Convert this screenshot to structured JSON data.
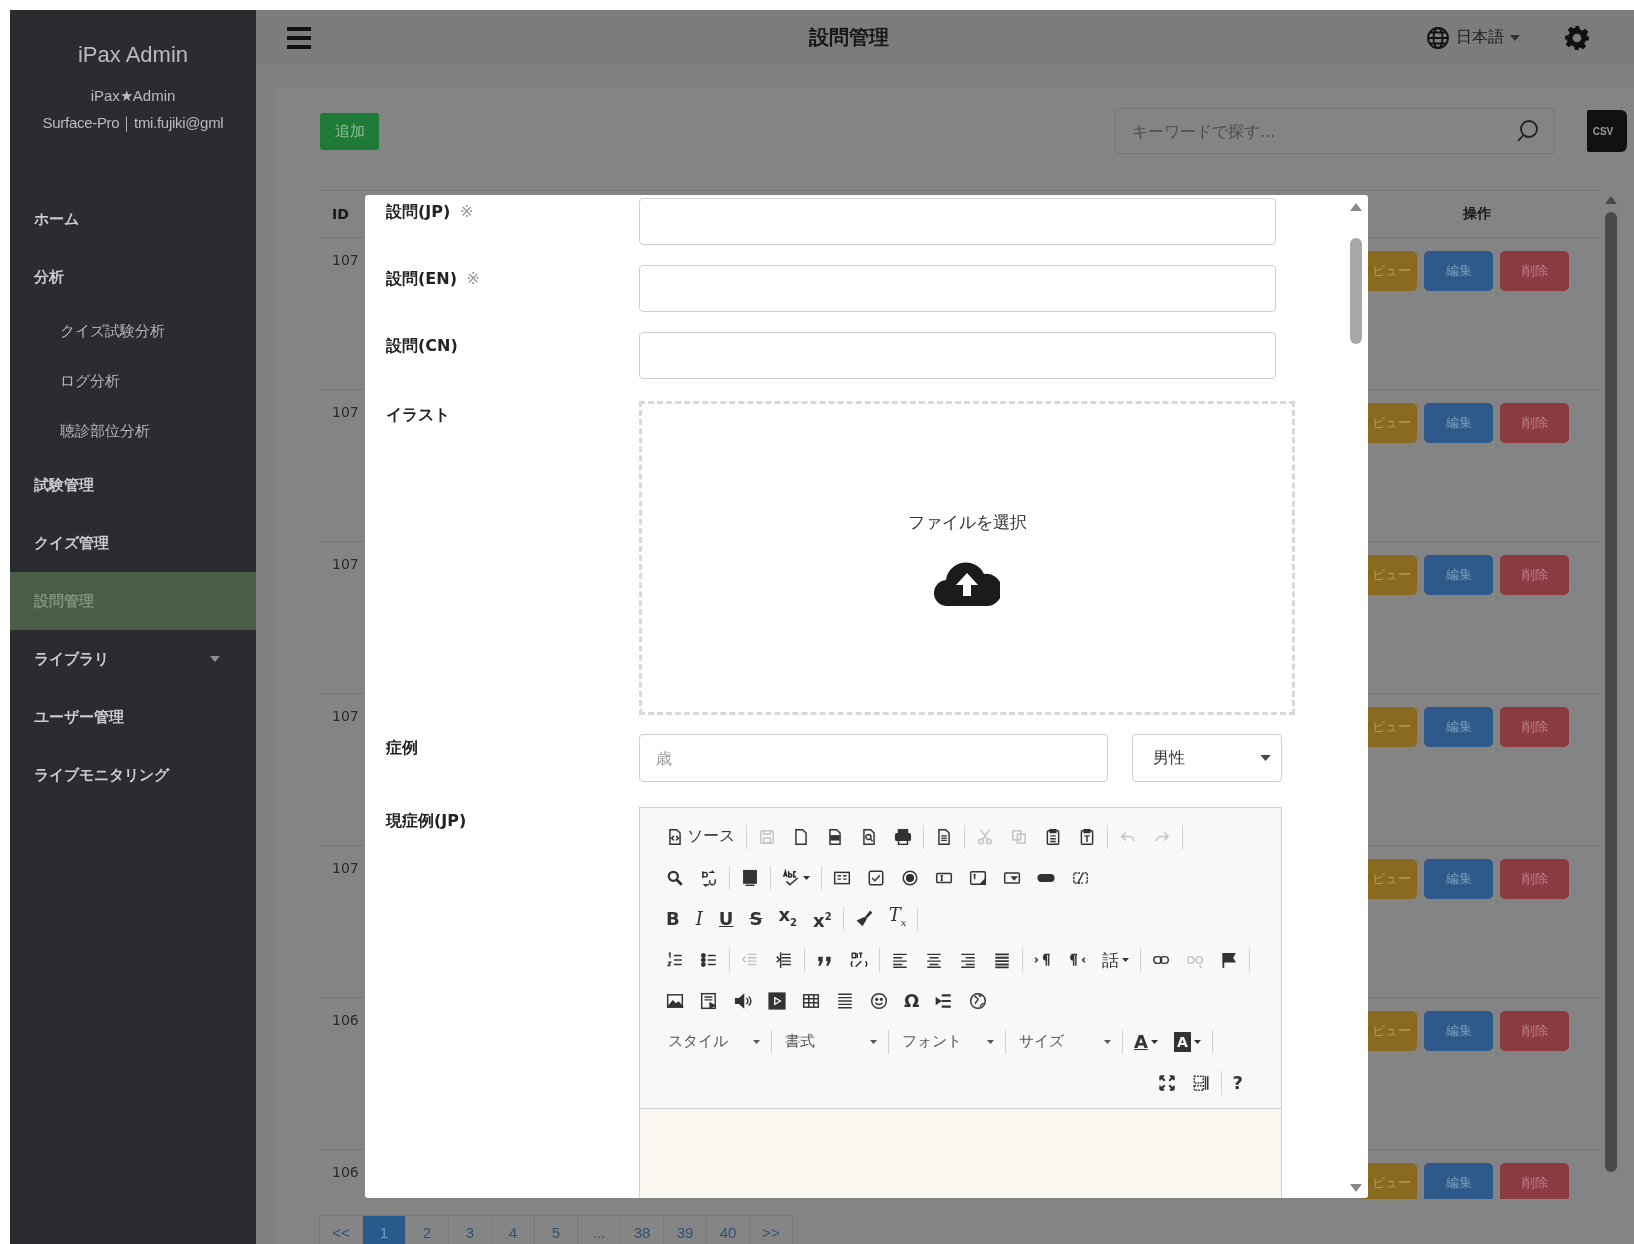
{
  "sidebar": {
    "title": "iPax Admin",
    "user": "iPax★Admin",
    "device": "Surface-Pro｜tmi.fujiki@gml",
    "items": [
      {
        "label": "ホーム",
        "kind": "link",
        "selected": false
      },
      {
        "label": "分析",
        "kind": "link",
        "selected": false,
        "children": [
          {
            "label": "クイズ試験分析",
            "selected": false
          },
          {
            "label": "ログ分析",
            "selected": false
          },
          {
            "label": "聴診部位分析",
            "selected": false
          }
        ]
      },
      {
        "label": "試験管理",
        "kind": "link",
        "selected": false
      },
      {
        "label": "クイズ管理",
        "kind": "link",
        "selected": false
      },
      {
        "label": "設問管理",
        "kind": "link",
        "selected": true
      },
      {
        "label": "ライブラリ",
        "kind": "group",
        "selected": false
      },
      {
        "label": "ユーザー管理",
        "kind": "link",
        "selected": false
      },
      {
        "label": "ライブモニタリング",
        "kind": "link",
        "selected": false
      }
    ]
  },
  "header": {
    "title": "設問管理",
    "language": "日本語"
  },
  "toolbar": {
    "add": "追加",
    "search_placeholder": "キーワードで探す...",
    "export": "CSV"
  },
  "table": {
    "columns": [
      "ID",
      "操作"
    ],
    "rows": [
      {
        "id": "107",
        "actions": [
          {
            "kind": "preview",
            "label": "ビュー"
          },
          {
            "kind": "edit",
            "label": "編集"
          },
          {
            "kind": "delete",
            "label": "削除"
          }
        ]
      },
      {
        "id": "107",
        "actions": [
          {
            "kind": "preview",
            "label": "ビュー"
          },
          {
            "kind": "edit",
            "label": "編集"
          },
          {
            "kind": "delete",
            "label": "削除"
          }
        ]
      },
      {
        "id": "107",
        "actions": [
          {
            "kind": "preview",
            "label": "ビュー"
          },
          {
            "kind": "edit",
            "label": "編集"
          },
          {
            "kind": "delete",
            "label": "削除"
          }
        ]
      },
      {
        "id": "107",
        "actions": [
          {
            "kind": "preview",
            "label": "ビュー"
          },
          {
            "kind": "edit",
            "label": "編集"
          },
          {
            "kind": "delete",
            "label": "削除"
          }
        ]
      },
      {
        "id": "107",
        "actions": [
          {
            "kind": "preview",
            "label": "ビュー"
          },
          {
            "kind": "edit",
            "label": "編集"
          },
          {
            "kind": "delete",
            "label": "削除"
          }
        ]
      },
      {
        "id": "106",
        "actions": [
          {
            "kind": "preview",
            "label": "ビュー"
          },
          {
            "kind": "edit",
            "label": "編集"
          },
          {
            "kind": "delete",
            "label": "削除"
          }
        ]
      },
      {
        "id": "106",
        "actions": [
          {
            "kind": "preview",
            "label": "ビュー"
          },
          {
            "kind": "edit",
            "label": "編集"
          },
          {
            "kind": "delete",
            "label": "削除"
          }
        ]
      }
    ]
  },
  "pagination": [
    {
      "label": "<<",
      "selected": false
    },
    {
      "label": "1",
      "selected": true
    },
    {
      "label": "2",
      "selected": false
    },
    {
      "label": "3",
      "selected": false
    },
    {
      "label": "4",
      "selected": false
    },
    {
      "label": "5",
      "selected": false
    },
    {
      "label": "...",
      "selected": false
    },
    {
      "label": "38",
      "selected": false
    },
    {
      "label": "39",
      "selected": false
    },
    {
      "label": "40",
      "selected": false
    },
    {
      "label": ">>",
      "selected": false
    }
  ],
  "modal": {
    "fields": [
      {
        "kind": "text",
        "label": "設問(JP)",
        "note": "※"
      },
      {
        "kind": "text",
        "label": "設問(EN)",
        "note": "※"
      },
      {
        "kind": "text",
        "label": "設問(CN)"
      },
      {
        "kind": "upload",
        "label": "イラスト",
        "prompt": "ファイルを選択"
      },
      {
        "kind": "case",
        "label": "症例",
        "age_placeholder": "歳",
        "sex": "男性"
      },
      {
        "kind": "editor",
        "label": "現症例(JP)",
        "toolbar": [
          [
            {
              "kind": "label_button",
              "label": "ソース"
            },
            {
              "kind": "sep"
            },
            {
              "kind": "icon",
              "disabled": true
            },
            {
              "kind": "icon",
              "disabled": false
            },
            {
              "kind": "icon",
              "disabled": false
            },
            {
              "kind": "icon",
              "disabled": false
            },
            {
              "kind": "icon",
              "disabled": false
            },
            {
              "kind": "sep"
            },
            {
              "kind": "icon",
              "disabled": false
            },
            {
              "kind": "sep"
            },
            {
              "kind": "icon",
              "disabled": true
            },
            {
              "kind": "icon",
              "disabled": true
            },
            {
              "kind": "icon",
              "disabled": false
            },
            {
              "kind": "icon",
              "disabled": false
            },
            {
              "kind": "sep"
            },
            {
              "kind": "icon",
              "disabled": true
            },
            {
              "kind": "icon",
              "disabled": true
            },
            {
              "kind": "sep"
            }
          ],
          [
            {
              "kind": "icon",
              "disabled": false
            },
            {
              "kind": "icon",
              "disabled": false
            },
            {
              "kind": "sep"
            },
            {
              "kind": "icon",
              "disabled": false
            },
            {
              "kind": "sep"
            },
            {
              "kind": "icon_menu",
              "disabled": false
            },
            {
              "kind": "sep"
            },
            {
              "kind": "icon",
              "disabled": false
            },
            {
              "kind": "icon",
              "disabled": false
            },
            {
              "kind": "icon",
              "disabled": false
            },
            {
              "kind": "icon",
              "disabled": false
            },
            {
              "kind": "icon",
              "disabled": false
            },
            {
              "kind": "icon",
              "disabled": false
            },
            {
              "kind": "icon",
              "disabled": false
            },
            {
              "kind": "icon",
              "disabled": false
            }
          ],
          [
            {
              "kind": "glyph",
              "text": "B",
              "disabled": false
            },
            {
              "kind": "glyph",
              "text": "I",
              "disabled": false
            },
            {
              "kind": "glyph",
              "text": "U",
              "disabled": false
            },
            {
              "kind": "glyph",
              "text": "S",
              "disabled": false
            },
            {
              "kind": "glyph",
              "text": "x$_{2}$",
              "disabled": false
            },
            {
              "kind": "glyph",
              "text": "x$^{2}$",
              "disabled": false
            },
            {
              "kind": "sep"
            },
            {
              "kind": "icon",
              "disabled": false
            },
            {
              "kind": "glyph",
              "text": "T$_{x}$",
              "disabled": false
            },
            {
              "kind": "sep"
            }
          ],
          [
            {
              "kind": "icon",
              "disabled": false
            },
            {
              "kind": "icon",
              "disabled": false
            },
            {
              "kind": "sep"
            },
            {
              "kind": "icon",
              "disabled": true
            },
            {
              "kind": "icon",
              "disabled": false
            },
            {
              "kind": "sep"
            },
            {
              "kind": "icon",
              "disabled": false
            },
            {
              "kind": "icon",
              "disabled": false
            },
            {
              "kind": "sep"
            },
            {
              "kind": "icon",
              "disabled": false
            },
            {
              "kind": "icon",
              "disabled": false
            },
            {
              "kind": "icon",
              "disabled": false
            },
            {
              "kind": "icon",
              "disabled": false
            },
            {
              "kind": "sep"
            },
            {
              "kind": "icon",
              "disabled": false
            },
            {
              "kind": "icon",
              "disabled": false
            },
            {
              "kind": "glyph_menu",
              "text": "話",
              "disabled": false
            },
            {
              "kind": "sep"
            },
            {
              "kind": "icon",
              "disabled": false
            },
            {
              "kind": "icon",
              "disabled": true
            },
            {
              "kind": "icon",
              "disabled": false
            },
            {
              "kind": "sep"
            }
          ],
          [
            {
              "kind": "icon",
              "disabled": false
            },
            {
              "kind": "icon",
              "disabled": false
            },
            {
              "kind": "icon",
              "disabled": false
            },
            {
              "kind": "icon",
              "disabled": false
            },
            {
              "kind": "icon",
              "disabled": false
            },
            {
              "kind": "icon",
              "disabled": false
            },
            {
              "kind": "icon",
              "disabled": false
            },
            {
              "kind": "glyph",
              "text": "Ω",
              "disabled": false
            },
            {
              "kind": "icon",
              "disabled": false
            },
            {
              "kind": "icon",
              "disabled": false
            }
          ],
          [
            {
              "kind": "dropdown",
              "label": "スタイル"
            },
            {
              "kind": "sep"
            },
            {
              "kind": "dropdown",
              "label": "書式"
            },
            {
              "kind": "sep"
            },
            {
              "kind": "dropdown",
              "label": "フォント"
            },
            {
              "kind": "sep"
            },
            {
              "kind": "dropdown",
              "label": "サイズ"
            },
            {
              "kind": "sep"
            },
            {
              "kind": "glyph_menu",
              "text": "A",
              "disabled": false
            },
            {
              "kind": "glyph_menu",
              "text": "A",
              "disabled": false
            },
            {
              "kind": "sep"
            }
          ],
          [
            {
              "kind": "icon",
              "disabled": false
            },
            {
              "kind": "icon",
              "disabled": false
            },
            {
              "kind": "sep"
            },
            {
              "kind": "glyph",
              "text": "?",
              "disabled": false
            }
          ]
        ]
      }
    ]
  }
}
